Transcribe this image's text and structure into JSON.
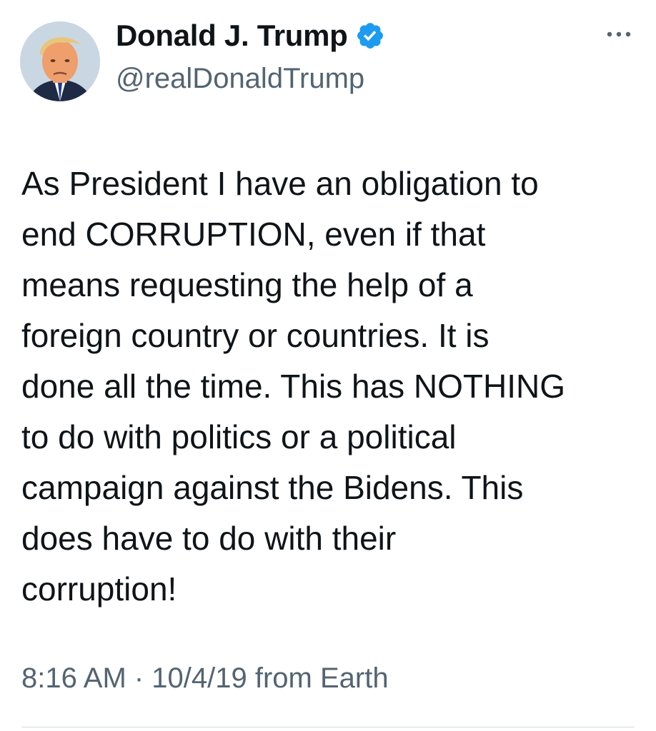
{
  "author": {
    "display_name": "Donald J. Trump",
    "handle": "@realDonaldTrump",
    "verified": true,
    "verified_color": "#1d9bf0",
    "avatar": "profile-photo"
  },
  "more_icon": "more-horizontal-icon",
  "tweet": {
    "lines": [
      "As President I have an obligation to",
      "end CORRUPTION, even if that",
      "means requesting the help of a",
      "foreign country or countries. It is",
      "done all the time. This has NOTHING",
      "to do with politics or a political",
      "campaign against the Bidens. This",
      "does have to do with their",
      "corruption!"
    ]
  },
  "meta": {
    "text": "8:16 AM · 10/4/19 from Earth"
  },
  "colors": {
    "text": "#0f1419",
    "secondary": "#536471",
    "divider": "#cfd9de"
  }
}
